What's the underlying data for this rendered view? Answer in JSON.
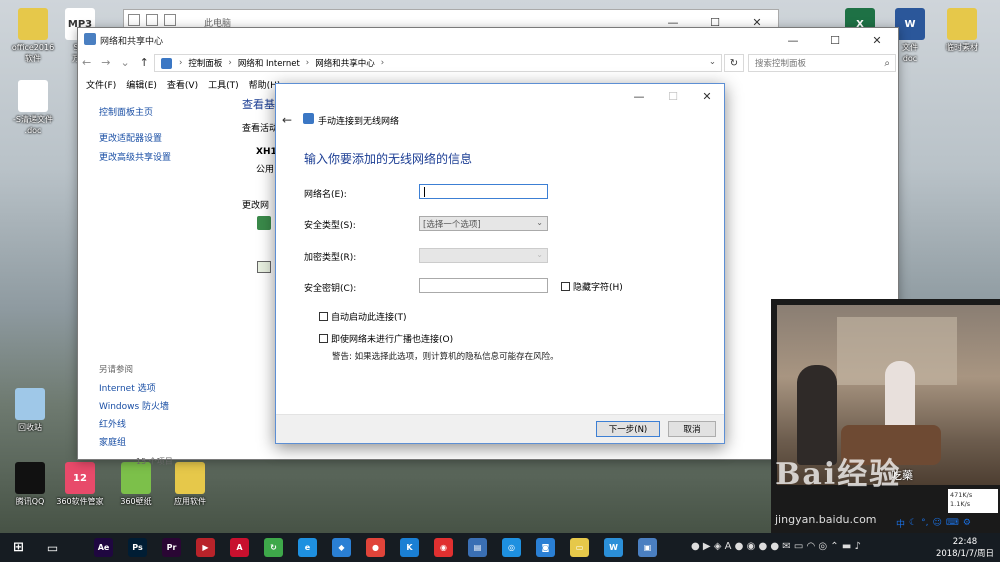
{
  "desktop": {
    "icons": [
      {
        "label": "office2016\n软件",
        "glyph": "",
        "color": "#e6c84a"
      },
      {
        "label": "S用\n万用",
        "glyph": "MP3",
        "color": "#ffffff"
      },
      {
        "label": "-S清递文件\n.doc",
        "glyph": "",
        "color": "#ffffff"
      },
      {
        "label": "回收站",
        "glyph": "",
        "color": "#9fc8e8"
      },
      {
        "label": "腾讯QQ",
        "glyph": "",
        "color": "#111111"
      },
      {
        "label": "360软件管家",
        "glyph": "12",
        "color": "#e84a6a"
      },
      {
        "label": "360壁纸",
        "glyph": "",
        "color": "#7cc04a"
      },
      {
        "label": "应用软件",
        "glyph": "",
        "color": "#e6c84a"
      },
      {
        "label": "",
        "glyph": "X",
        "color": "#1e7145"
      },
      {
        "label": "文件\ndoc",
        "glyph": "W",
        "color": "#2b579a"
      },
      {
        "label": "临时素材",
        "glyph": "",
        "color": "#e6c84a"
      }
    ]
  },
  "explorer": {
    "title": "此电脑"
  },
  "netwin": {
    "title": "网络和共享中心",
    "nav": {
      "back": "←",
      "forward": "→",
      "dropdown": "⌄",
      "up": "↑"
    },
    "breadcrumb": [
      "控制面板",
      "网络和 Internet",
      "网络和共享中心"
    ],
    "search_placeholder": "搜索控制面板",
    "menu": [
      "文件(F)",
      "编辑(E)",
      "查看(V)",
      "工具(T)",
      "帮助(H)"
    ],
    "side_links": [
      "控制面板主页",
      "更改适配器设置",
      "更改高级共享设置"
    ],
    "see_also_title": "另请参阅",
    "see_also": [
      "Internet 选项",
      "Windows 防火墙",
      "红外线",
      "家庭组"
    ],
    "main_title": "查看基",
    "main_sub": "查看活动",
    "network_name": "XH1",
    "network_type": "公用",
    "change_net": "更改网",
    "status_bar": "15 个项目"
  },
  "dialog": {
    "title": "手动连接到无线网络",
    "heading": "输入你要添加的无线网络的信息",
    "fields": {
      "ssid_label": "网络名(E):",
      "security_label": "安全类型(S):",
      "security_value": "[选择一个选项]",
      "encryption_label": "加密类型(R):",
      "key_label": "安全密钥(C):",
      "hide_chars": "隐藏字符(H)"
    },
    "auto_connect": "自动启动此连接(T)",
    "connect_hidden": "即使网络未进行广播也连接(O)",
    "warning": "警告: 如果选择此选项，则计算机的隐私信息可能存在风险。",
    "next": "下一步(N)",
    "cancel": "取消"
  },
  "video": {
    "subtitle": "吃藥",
    "watermark": "Bai经验",
    "watermark_url": "jingyan.baidu.com",
    "upload": "471K/s",
    "download": "1.1K/s",
    "tray_cn": "中"
  },
  "taskbar": {
    "apps": [
      {
        "glyph": "Ae",
        "color": "#1f0740"
      },
      {
        "glyph": "Ps",
        "color": "#001d34"
      },
      {
        "glyph": "Pr",
        "color": "#2a0634"
      },
      {
        "glyph": "▶",
        "color": "#b8232a"
      },
      {
        "glyph": "A",
        "color": "#c8102e"
      },
      {
        "glyph": "↻",
        "color": "#3ea84a"
      },
      {
        "glyph": "e",
        "color": "#1e90e0"
      },
      {
        "glyph": "◆",
        "color": "#2a7fd4"
      },
      {
        "glyph": "●",
        "color": "#e0443a"
      },
      {
        "glyph": "K",
        "color": "#1a7fd4"
      },
      {
        "glyph": "◉",
        "color": "#e03030"
      },
      {
        "glyph": "▤",
        "color": "#3a6fb4"
      },
      {
        "glyph": "◎",
        "color": "#1e90e0"
      },
      {
        "glyph": "◙",
        "color": "#2a7fd4"
      },
      {
        "glyph": "▭",
        "color": "#e6c84a"
      },
      {
        "glyph": "W",
        "color": "#2b8fd8"
      },
      {
        "glyph": "▣",
        "color": "#4a7fc1"
      }
    ],
    "time": "22:48",
    "date": "2018/1/7/周日"
  }
}
